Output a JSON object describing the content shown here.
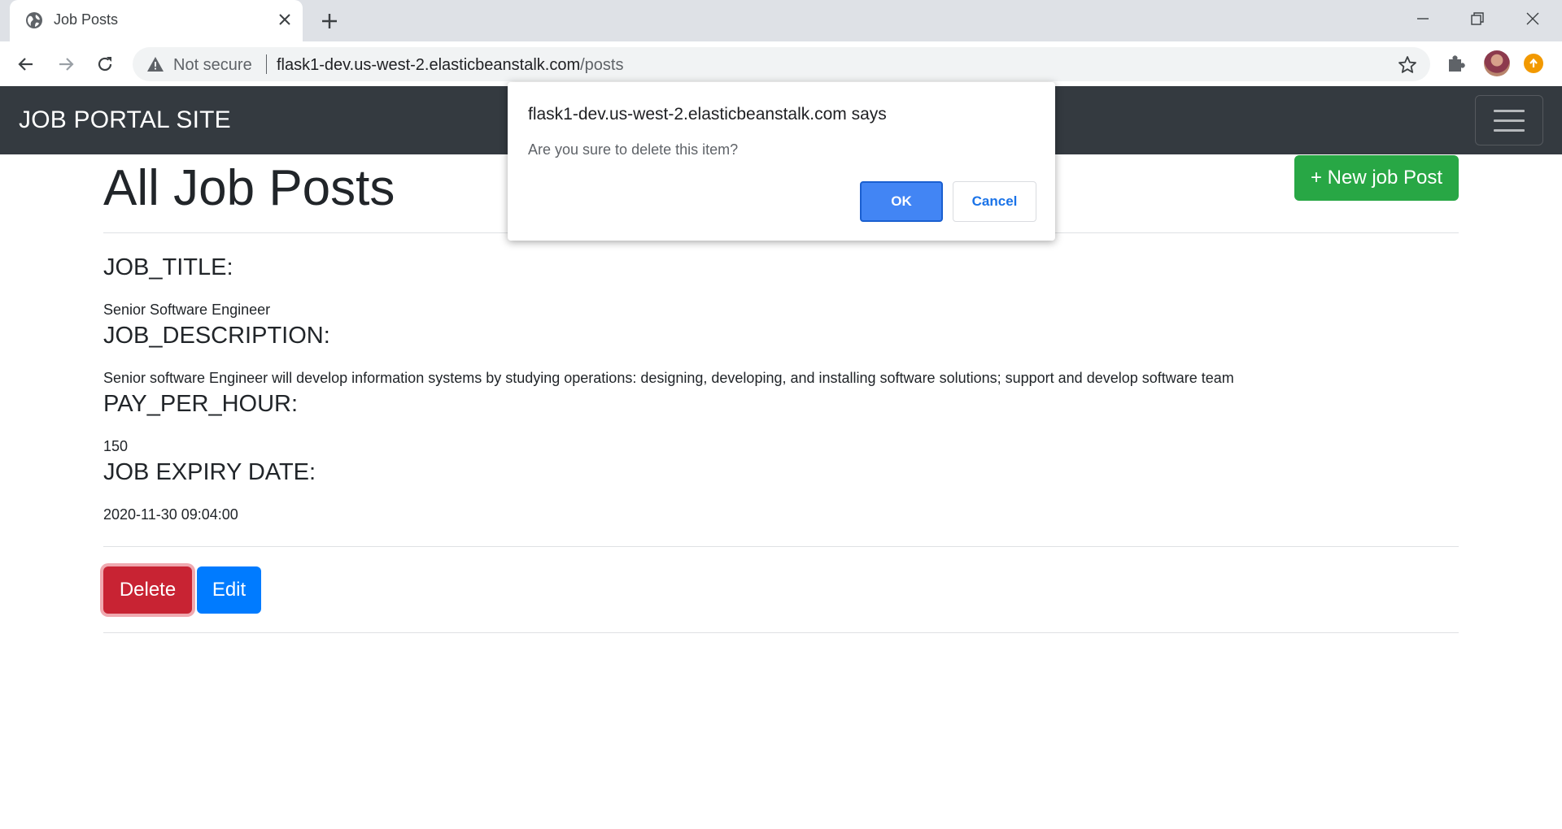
{
  "browser": {
    "tab_title": "Job Posts",
    "security_label": "Not secure",
    "url_host": "flask1-dev.us-west-2.elasticbeanstalk.com",
    "url_path": "/posts"
  },
  "navbar": {
    "brand": "JOB PORTAL SITE"
  },
  "page": {
    "title": "All Job Posts",
    "new_post_label": "+ New job Post"
  },
  "post": {
    "fields": [
      {
        "label": "JOB_TITLE:",
        "value": "Senior Software Engineer"
      },
      {
        "label": "JOB_DESCRIPTION:",
        "value": "Senior software Engineer will develop information systems by studying operations: designing, developing, and installing software solutions; support and develop software team"
      },
      {
        "label": "PAY_PER_HOUR:",
        "value": "150"
      },
      {
        "label": "JOB EXPIRY DATE:",
        "value": "2020-11-30 09:04:00"
      }
    ],
    "delete_label": "Delete",
    "edit_label": "Edit"
  },
  "dialog": {
    "origin": "flask1-dev.us-west-2.elasticbeanstalk.com says",
    "message": "Are you sure to delete this item?",
    "ok_label": "OK",
    "cancel_label": "Cancel",
    "ok_color": "#4285f4"
  },
  "colors": {
    "navbar": "#343a40",
    "success": "#28a745",
    "danger": "#c82333",
    "primary": "#007bff"
  }
}
